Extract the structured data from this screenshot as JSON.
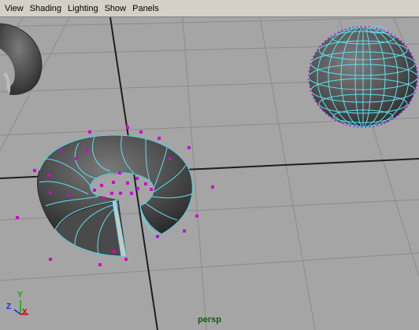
{
  "menubar": {
    "items": [
      {
        "label": "View"
      },
      {
        "label": "Shading"
      },
      {
        "label": "Lighting"
      },
      {
        "label": "Show"
      },
      {
        "label": "Panels"
      }
    ]
  },
  "viewport": {
    "camera": "persp",
    "axes": {
      "x": "X",
      "y": "Y",
      "z": "Z"
    },
    "objects": [
      "torus-partial",
      "torus-selected",
      "sphere-selected"
    ]
  },
  "colors": {
    "menubar_bg": "#d4d0c8",
    "viewport_bg": "#a5a5a5",
    "grid": "#8c8c8c",
    "grid_axis": "#1e1e1e",
    "selection_wire": "#5fe0f0",
    "component": "#d400d4",
    "camera_label": "#145a14",
    "axis_x": "#e00000",
    "axis_y": "#00b000",
    "axis_z": "#1a2ad0"
  }
}
